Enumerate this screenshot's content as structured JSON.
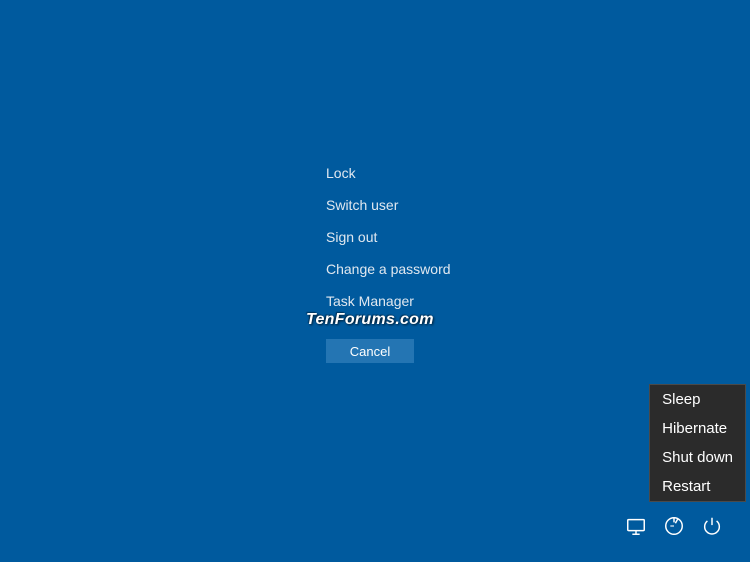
{
  "menu": {
    "items": [
      {
        "label": "Lock"
      },
      {
        "label": "Switch user"
      },
      {
        "label": "Sign out"
      },
      {
        "label": "Change a password"
      },
      {
        "label": "Task Manager"
      }
    ],
    "cancel_label": "Cancel"
  },
  "watermark": "TenForums.com",
  "power_menu": {
    "items": [
      {
        "label": "Sleep"
      },
      {
        "label": "Hibernate"
      },
      {
        "label": "Shut down"
      },
      {
        "label": "Restart"
      }
    ]
  },
  "icons": {
    "network": "network-icon",
    "ease_of_access": "ease-of-access-icon",
    "power": "power-icon"
  }
}
